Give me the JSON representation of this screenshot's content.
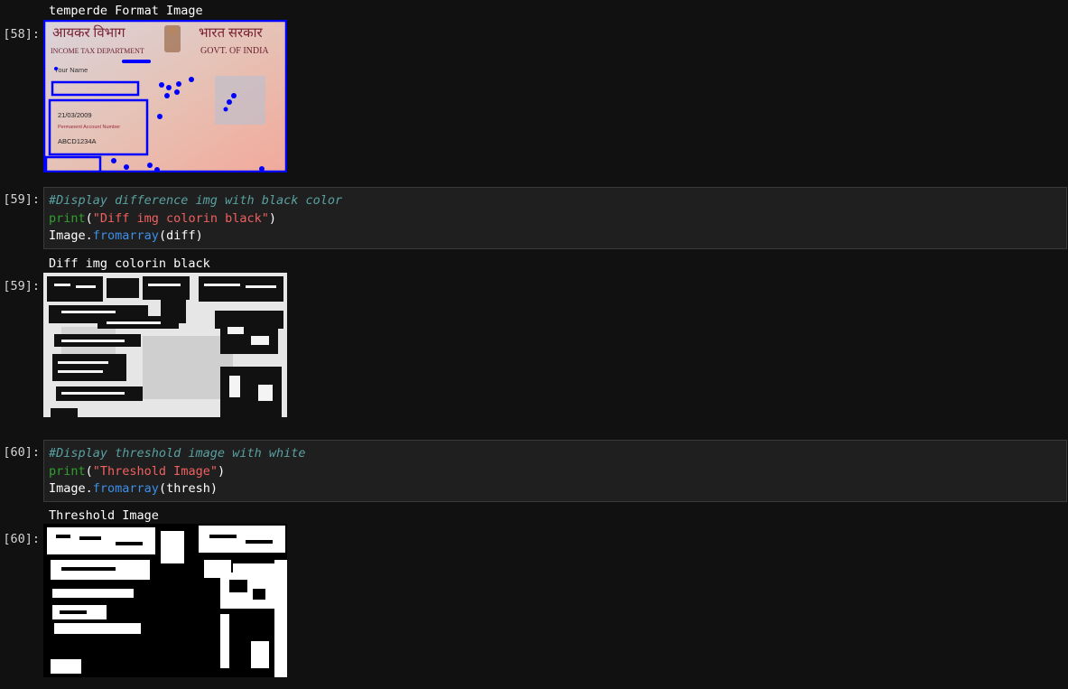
{
  "cells": [
    {
      "output_prompt": "[58]:",
      "stdout": "temperde Format Image",
      "card": {
        "hindi_left": "आयकर विभाग",
        "dept_label": "INCOME TAX DEPARTMENT",
        "hindi_right": "भारत सरकार",
        "govt_label": "GOVT. OF INDIA",
        "name_label": "Your Name",
        "dob": "21/03/2009",
        "pan_label": "Permanent Account Number",
        "pan_number": "ABCD1234A"
      }
    },
    {
      "input_prompt": "[59]:",
      "comment": "#Display difference img with black color",
      "print_fn": "print",
      "print_open": "(",
      "print_str": "\"Diff img colorin black\"",
      "print_close": ")",
      "image_obj": "Image.",
      "image_method": "fromarray",
      "image_args": "(diff)",
      "output_prompt": "[59]:",
      "stdout": "Diff img colorin black"
    },
    {
      "input_prompt": "[60]:",
      "comment": "#Display threshold image with white",
      "print_fn": "print",
      "print_open": "(",
      "print_str": "\"Threshold Image\"",
      "print_close": ")",
      "image_obj": "Image.",
      "image_method": "fromarray",
      "image_args": "(thresh)",
      "output_prompt": "[60]:",
      "stdout": "Threshold Image"
    }
  ],
  "colors": {
    "background": "#111111",
    "code_cell_bg": "#1f1f1f",
    "comment": "#5aa1a1",
    "keyword": "#2fa12f",
    "string": "#f0605f",
    "function": "#3d8ee6",
    "contour": "#0000ff"
  }
}
